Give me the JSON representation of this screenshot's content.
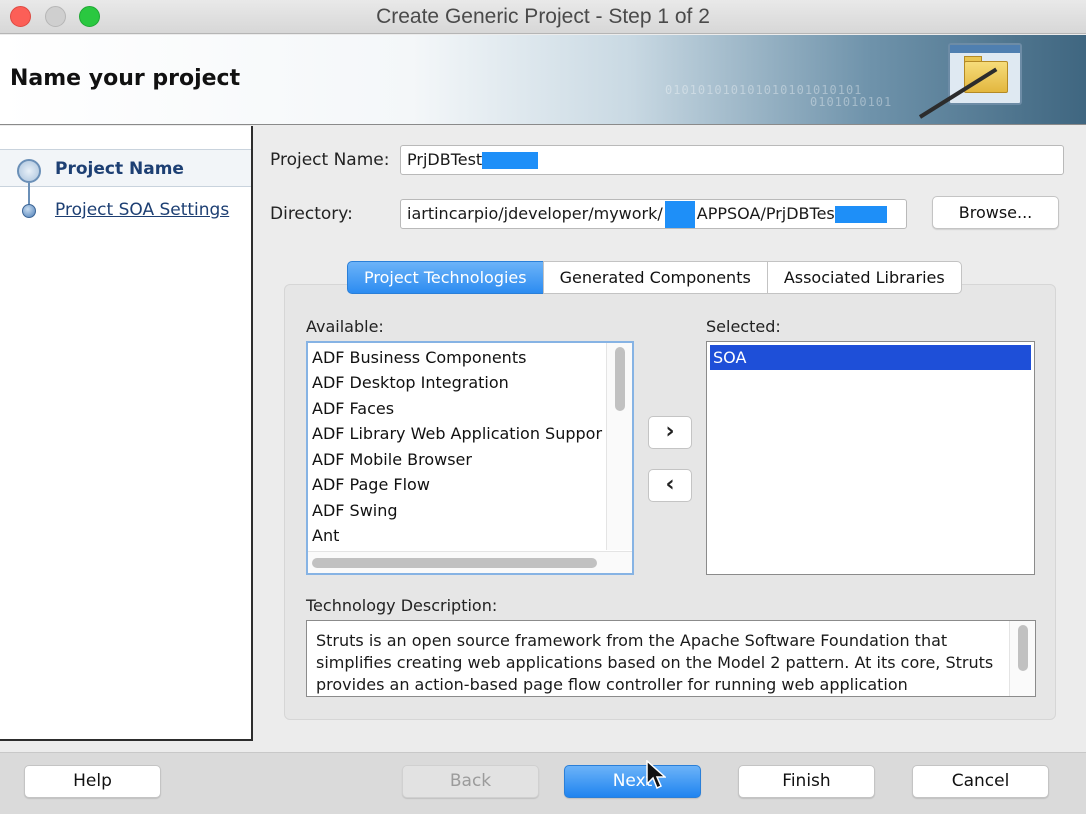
{
  "window": {
    "title": "Create Generic Project - Step 1 of 2"
  },
  "header": {
    "title": "Name your project",
    "binary_line1": "010101010101010101010101",
    "binary_line2": "0101010101"
  },
  "nav": {
    "items": [
      {
        "label": "Project Name",
        "selected": true
      },
      {
        "label": "Project SOA Settings",
        "selected": false
      }
    ]
  },
  "form": {
    "project_name_label": "Project Name:",
    "project_name_value": "PrjDBTest",
    "directory_label": "Directory:",
    "directory_value_part1": "iartincarpio/jdeveloper/mywork/",
    "directory_value_part2": "APPSOA/PrjDBTes",
    "browse_label": "Browse..."
  },
  "tabs": [
    {
      "label": "Project Technologies",
      "active": true
    },
    {
      "label": "Generated Components",
      "active": false
    },
    {
      "label": "Associated Libraries",
      "active": false
    }
  ],
  "available": {
    "label": "Available:",
    "items": [
      "ADF Business Components",
      "ADF Desktop Integration",
      "ADF Faces",
      "ADF Library Web Application Suppor",
      "ADF Mobile Browser",
      "ADF Page Flow",
      "ADF Swing",
      "Ant"
    ]
  },
  "selected": {
    "label": "Selected:",
    "items": [
      "SOA"
    ]
  },
  "arrows": {
    "add": "›",
    "remove": "‹"
  },
  "description": {
    "label": "Technology Description:",
    "text": "Struts is an open source framework from the Apache Software Foundation that simplifies creating web applications based on the Model 2 pattern. At its core, Struts provides an action-based page flow controller for running web application"
  },
  "footer": {
    "help": "Help",
    "back": "Back",
    "next": "Next",
    "finish": "Finish",
    "cancel": "Cancel"
  },
  "colors": {
    "accent": "#2c8cf1",
    "selection": "#1e4fd8",
    "redaction": "#1e8ff8"
  }
}
